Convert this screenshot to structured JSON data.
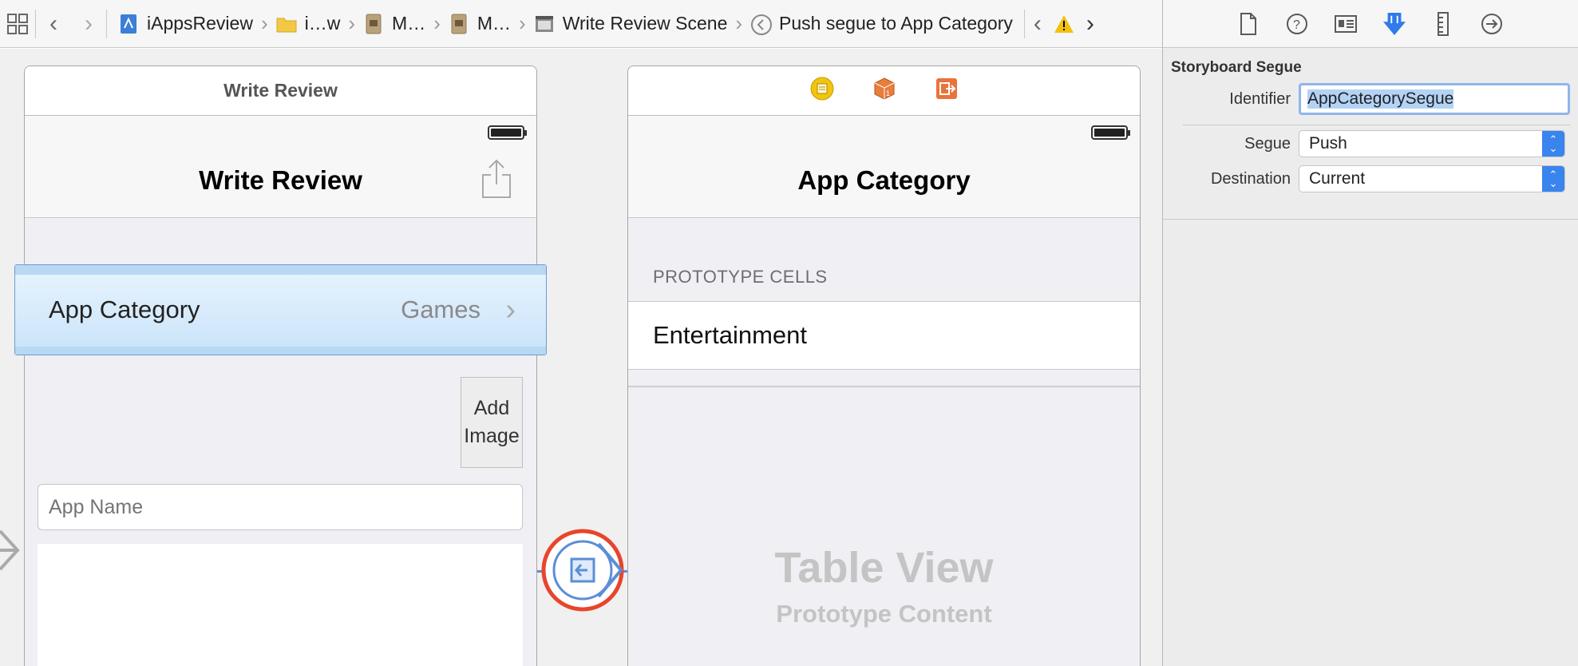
{
  "jumpbar": {
    "crumbs": [
      "iAppsReview",
      "i…w",
      "M…",
      "M…",
      "Write Review Scene",
      "Push segue to App Category"
    ]
  },
  "inspector": {
    "section_title": "Storyboard Segue",
    "identifier_label": "Identifier",
    "identifier_value": "AppCategorySegue",
    "segue_label": "Segue",
    "segue_value": "Push",
    "destination_label": "Destination",
    "destination_value": "Current"
  },
  "write_review": {
    "scene_title": "Write Review",
    "nav_title": "Write Review",
    "cell_label": "App Category",
    "cell_detail": "Games",
    "add_image_line1": "Add",
    "add_image_line2": "Image",
    "app_name_placeholder": "App Name"
  },
  "app_category": {
    "nav_title": "App Category",
    "section_header": "PROTOTYPE CELLS",
    "cell_label": "Entertainment",
    "placeholder_title": "Table View",
    "placeholder_subtitle": "Prototype Content"
  },
  "colors": {
    "accent": "#3a84ee",
    "segue_ring": "#e8452c",
    "selection": "#cfe6fb"
  }
}
